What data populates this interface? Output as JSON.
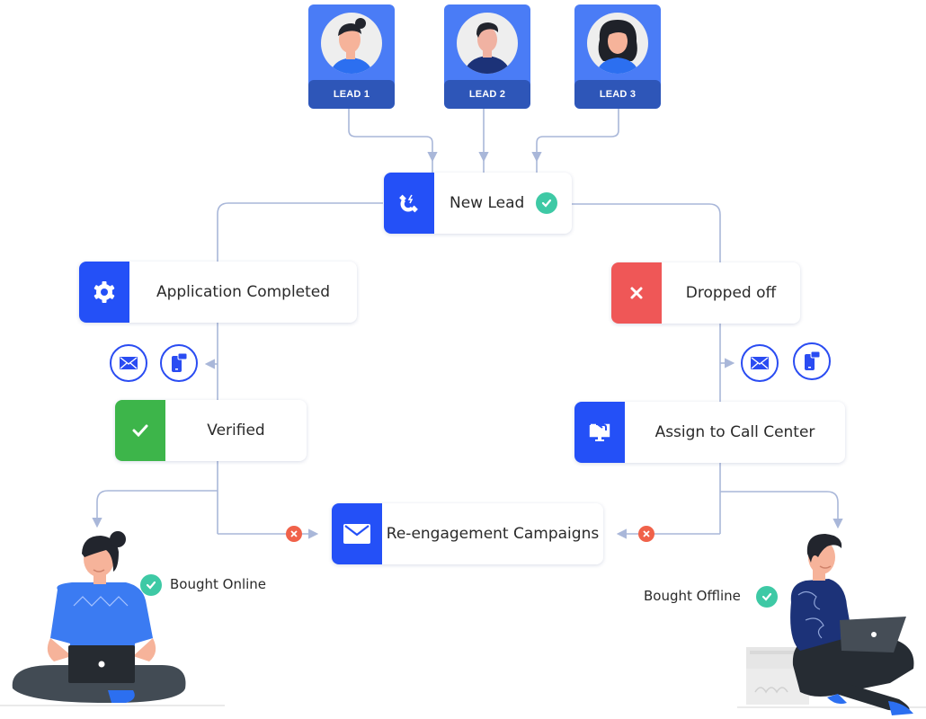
{
  "leads": [
    {
      "label": "LEAD 1",
      "avatar": "woman-with-bun-avatar"
    },
    {
      "label": "LEAD 2",
      "avatar": "man-avatar"
    },
    {
      "label": "LEAD 3",
      "avatar": "woman-curly-hair-avatar"
    }
  ],
  "nodes": {
    "new_lead": {
      "label": "New Lead",
      "icon": "magnet-icon",
      "color": "#2450f7",
      "status": "check"
    },
    "application_completed": {
      "label": "Application Completed",
      "icon": "gear-icon",
      "color": "#2450f7"
    },
    "dropped_off": {
      "label": "Dropped off",
      "icon": "x-icon",
      "color": "#ef5757"
    },
    "verified": {
      "label": "Verified",
      "icon": "check-icon",
      "color": "#3db54a"
    },
    "assign_call_center": {
      "label": "Assign to Call Center",
      "icon": "monitor-transfer-icon",
      "color": "#2450f7"
    },
    "reengagement": {
      "label": "Re-engagement Campaigns",
      "icon": "envelope-icon",
      "color": "#2450f7"
    }
  },
  "channels": {
    "left": [
      "email-icon",
      "mobile-message-icon"
    ],
    "right": [
      "email-icon",
      "mobile-message-icon"
    ]
  },
  "outcomes": {
    "online": {
      "label": "Bought Online"
    },
    "offline": {
      "label": "Bought Offline"
    }
  },
  "colors": {
    "connector": "#a9b7d9",
    "primary": "#2450f7",
    "lead_card": "#4a7cf6",
    "lead_band": "#2e56b8",
    "success": "#3ec9a5",
    "danger": "#f0624a"
  }
}
